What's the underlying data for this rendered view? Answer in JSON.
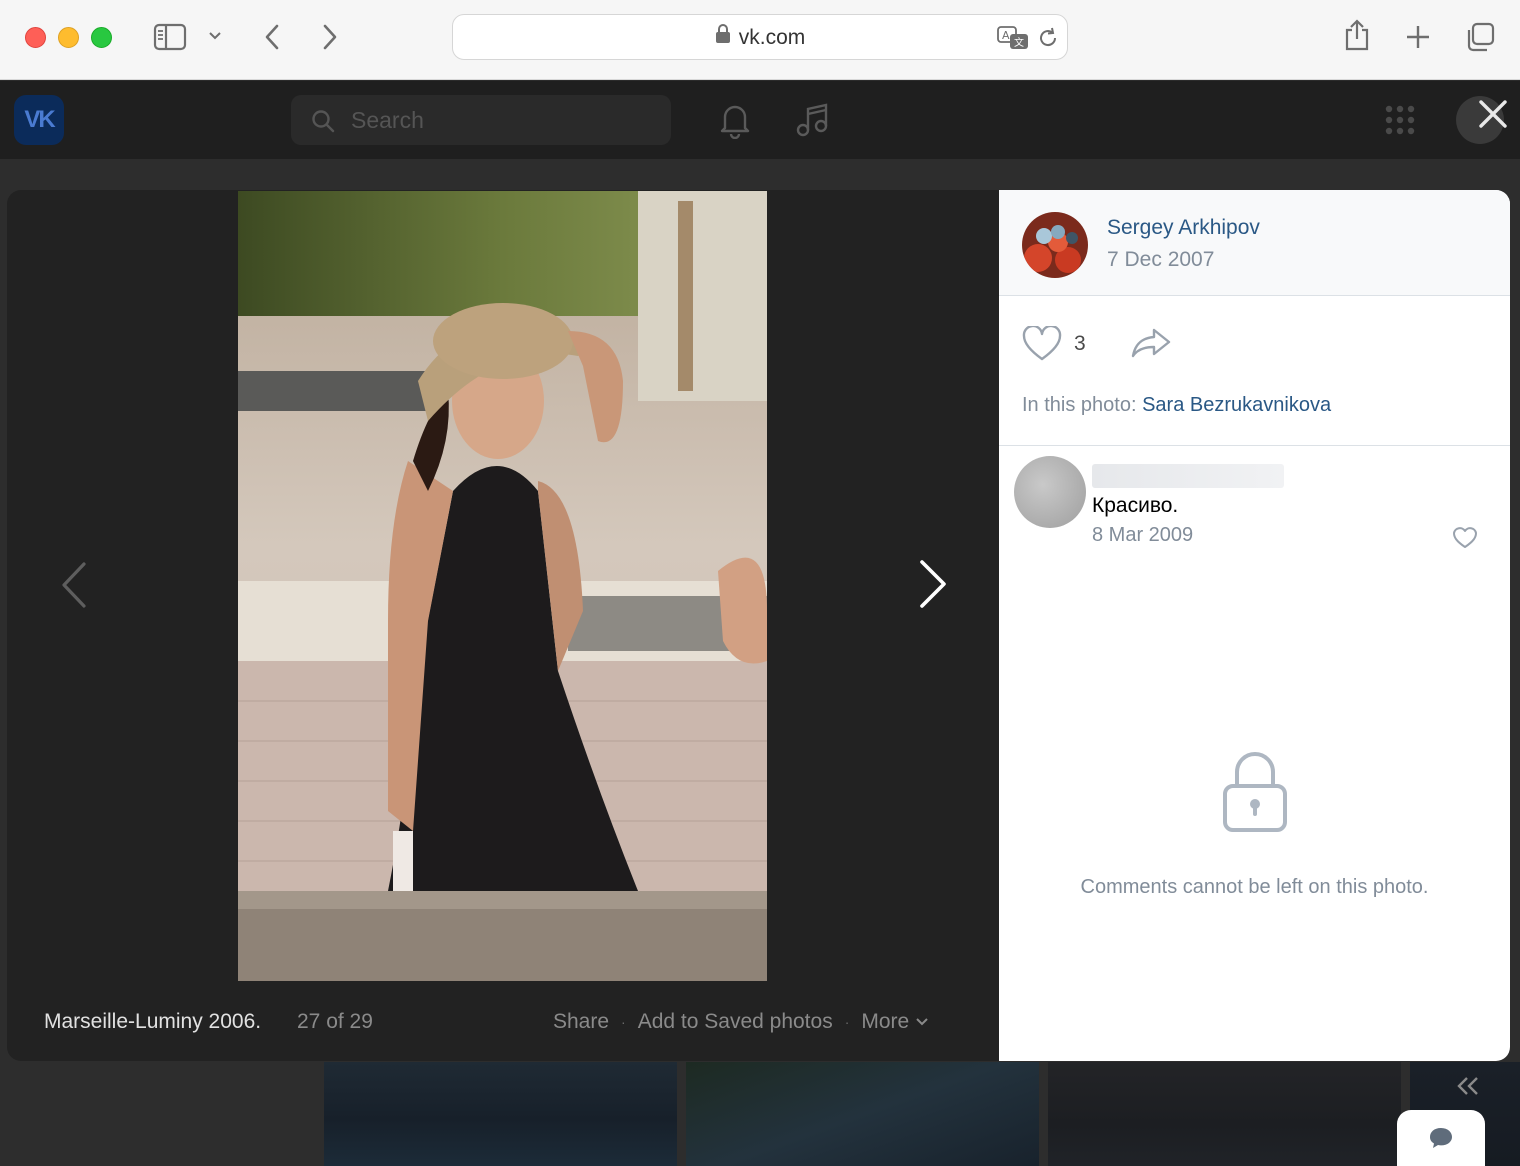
{
  "browser": {
    "url": "vk.com",
    "icons": [
      "sidebar-icon",
      "chevron-down-icon",
      "back-icon",
      "forward-icon",
      "translate-icon",
      "reload-icon",
      "share-icon",
      "new-tab-icon",
      "tabs-overview-icon"
    ]
  },
  "vk_header": {
    "logo": "VK",
    "search_placeholder": "Search"
  },
  "viewer": {
    "caption": "Marseille-Luminy 2006.",
    "counter": "27 of 29",
    "actions": {
      "share": "Share",
      "save": "Add to Saved photos",
      "more": "More"
    }
  },
  "panel": {
    "author": "Sergey Arkhipov",
    "date": "7 Dec 2007",
    "likes": "3",
    "in_photo_label": "In this photo:",
    "in_photo_name": "Sara Bezrukavnikova",
    "comment": {
      "text": "Красиво.",
      "date": "8 Mar 2009"
    },
    "locked_message": "Comments cannot be left on this photo."
  },
  "colors": {
    "link": "#2a5885",
    "secondary": "#818c99",
    "viewer_bg": "#222222"
  }
}
